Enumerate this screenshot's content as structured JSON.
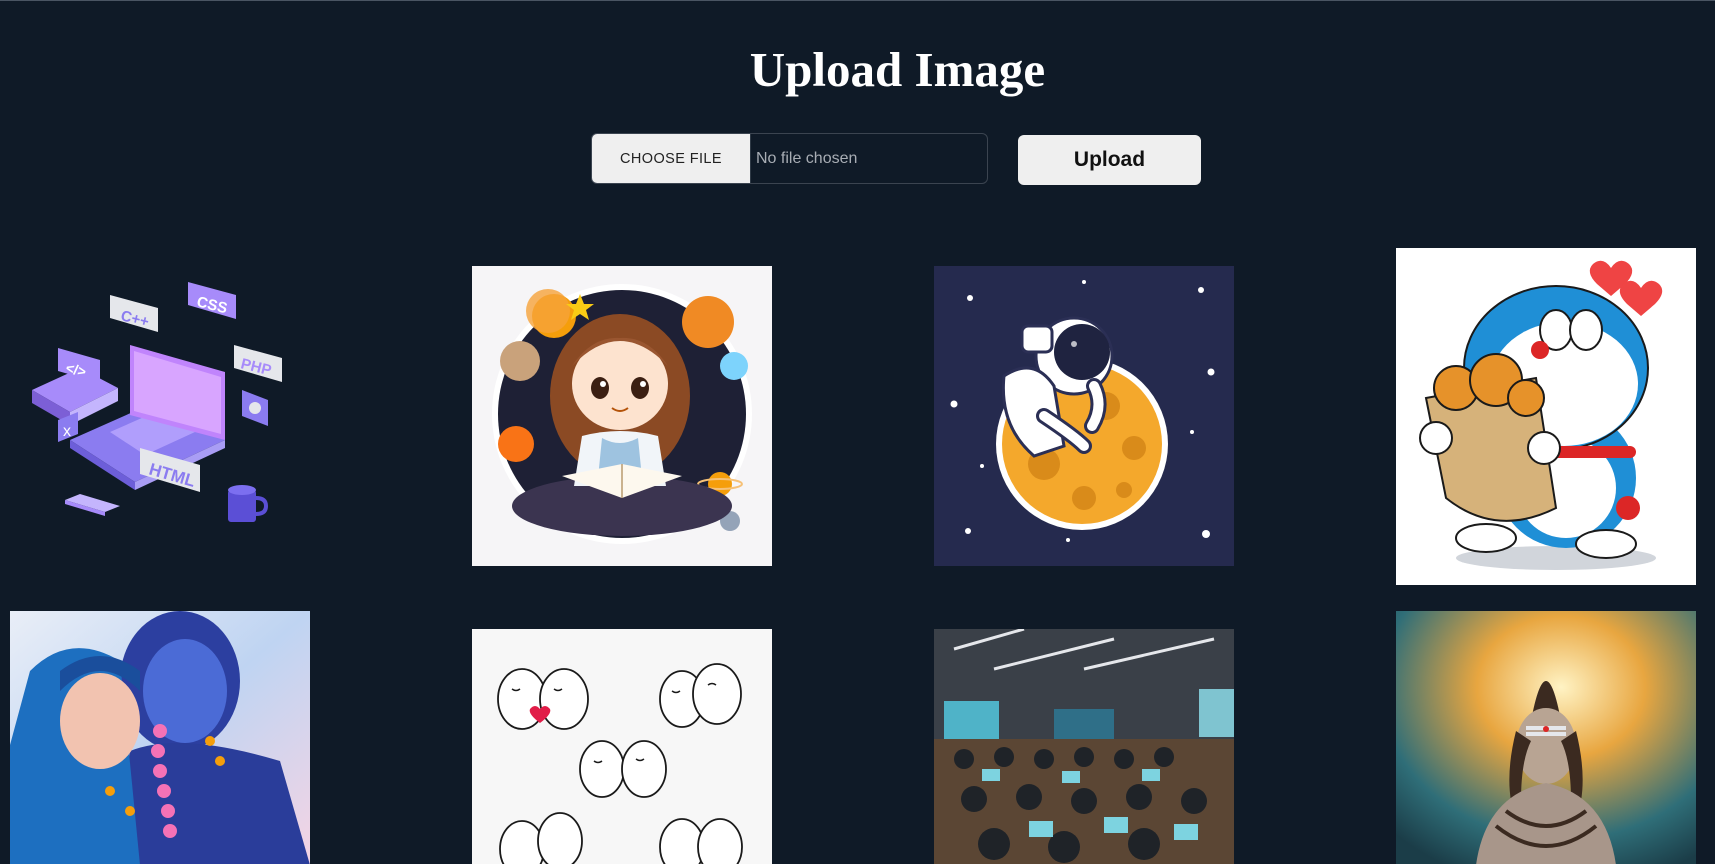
{
  "page": {
    "title": "Upload Image"
  },
  "uploader": {
    "choose_label": "CHOOSE FILE",
    "file_status": "No file chosen",
    "upload_label": "Upload"
  },
  "gallery": {
    "images": [
      {
        "name": "coding-laptop-illustration",
        "labels": [
          "C++",
          "CSS",
          "PHP",
          "</>",
          "HTML"
        ]
      },
      {
        "name": "girl-reading-space-sticker"
      },
      {
        "name": "astronaut-on-moon"
      },
      {
        "name": "doraemon-with-dorayaki"
      },
      {
        "name": "radha-krishna-art"
      },
      {
        "name": "couple-doodle-stickers"
      },
      {
        "name": "computer-lab-students"
      },
      {
        "name": "shiva-meditating-art"
      }
    ]
  },
  "colors": {
    "background": "#0f1a27",
    "button_bg": "#efefef",
    "title_text": "#ffffff"
  }
}
